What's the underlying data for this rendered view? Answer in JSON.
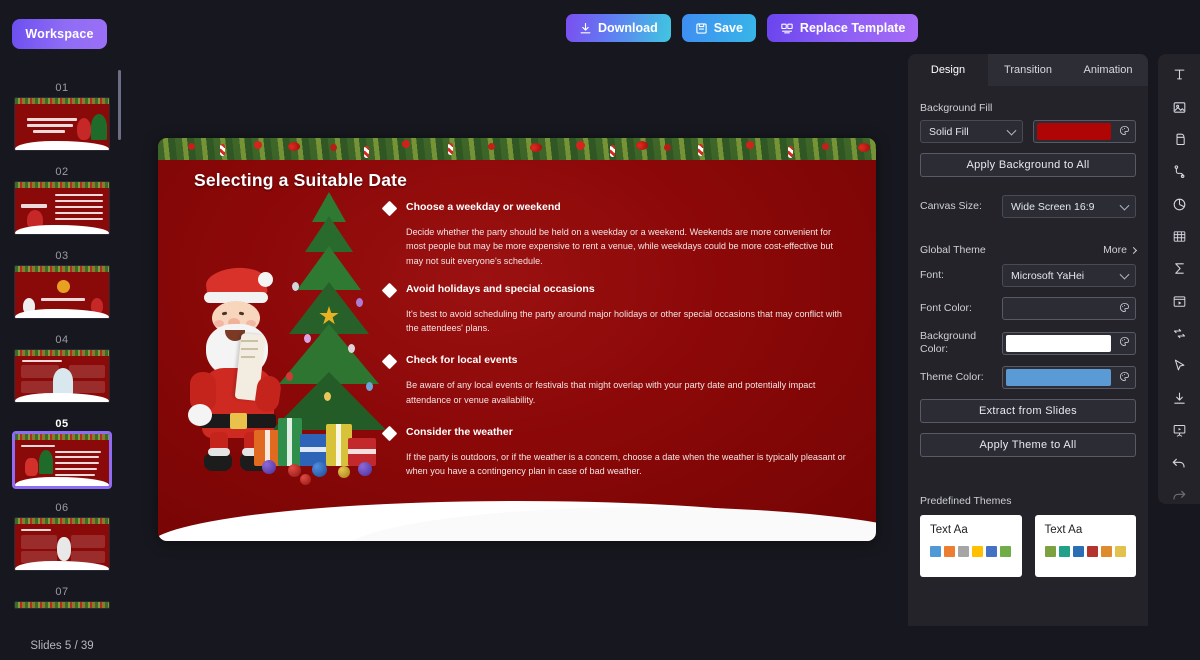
{
  "topbar": {
    "workspace_label": "Workspace",
    "download_label": "Download",
    "save_label": "Save",
    "replace_label": "Replace Template"
  },
  "rail": {
    "slides_count_label": "Slides 5 / 39",
    "thumbnails": [
      {
        "num": "01",
        "active": false
      },
      {
        "num": "02",
        "active": false
      },
      {
        "num": "03",
        "active": false
      },
      {
        "num": "04",
        "active": false
      },
      {
        "num": "05",
        "active": true
      },
      {
        "num": "06",
        "active": false
      },
      {
        "num": "07",
        "active": false
      }
    ]
  },
  "slide": {
    "title": "Selecting a Suitable Date",
    "background_color": "#8b0808",
    "bullets": [
      {
        "heading": "Choose a weekday or weekend",
        "body": "Decide whether the party should be held on a weekday or a weekend. Weekends are more convenient for most people but may be more expensive to rent a venue, while weekdays could be more cost-effective but may not suit everyone's schedule."
      },
      {
        "heading": "Avoid holidays and special occasions",
        "body": "It's best to avoid scheduling the party around major holidays or other special occasions that may conflict with the attendees' plans."
      },
      {
        "heading": "Check for local events",
        "body": "Be aware of any local events or festivals that might overlap with your party date and potentially impact attendance or venue availability."
      },
      {
        "heading": "Consider the weather",
        "body": "If the party is outdoors, or if the weather is a concern, choose a date when the weather is typically pleasant or when you have a contingency plan in case of bad weather."
      }
    ]
  },
  "panel": {
    "tabs": [
      {
        "label": "Design",
        "active": true
      },
      {
        "label": "Transition",
        "active": false
      },
      {
        "label": "Animation",
        "active": false
      }
    ],
    "background_fill_label": "Background Fill",
    "fill_type_value": "Solid Fill",
    "fill_color_value": "#b00505",
    "apply_background_label": "Apply Background to All",
    "canvas_size_label": "Canvas Size:",
    "canvas_size_value": "Wide Screen 16:9",
    "global_theme_label": "Global Theme",
    "more_label": "More",
    "font_label": "Font:",
    "font_value": "Microsoft YaHei",
    "font_color_label": "Font Color:",
    "font_color_value": "#2c2c34",
    "background_color_label": "Background Color:",
    "background_color_value": "#ffffff",
    "theme_color_label": "Theme Color:",
    "theme_color_value": "#5b9bd5",
    "extract_label": "Extract from Slides",
    "apply_theme_label": "Apply Theme to All",
    "predefined_themes_label": "Predefined Themes",
    "themes": [
      {
        "text": "Text Aa",
        "colors": [
          "#4f9ad6",
          "#ed7d31",
          "#a5a5a5",
          "#ffc000",
          "#4472c4",
          "#70ad47"
        ]
      },
      {
        "text": "Text Aa",
        "colors": [
          "#7ba23f",
          "#21a08a",
          "#2a6fb5",
          "#b4332c",
          "#e08a2e",
          "#e3c14d"
        ]
      }
    ]
  },
  "iconbar": {
    "icons": [
      {
        "name": "text-icon"
      },
      {
        "name": "image-icon"
      },
      {
        "name": "shape-icon"
      },
      {
        "name": "connector-icon"
      },
      {
        "name": "chart-icon"
      },
      {
        "name": "table-icon"
      },
      {
        "name": "formula-icon"
      },
      {
        "name": "media-icon"
      },
      {
        "name": "flowchart-icon"
      },
      {
        "name": "cursor-icon"
      },
      {
        "name": "import-icon"
      },
      {
        "name": "present-icon"
      },
      {
        "name": "undo-icon"
      },
      {
        "name": "redo-icon"
      }
    ]
  }
}
